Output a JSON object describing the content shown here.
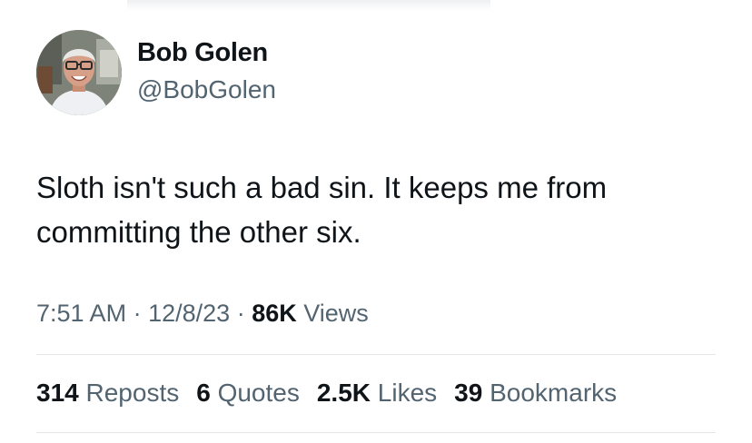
{
  "author": {
    "name": "Bob Golen",
    "handle": "@BobGolen"
  },
  "tweet": {
    "text": "Sloth isn't such a bad sin. It keeps me from committing the other six."
  },
  "meta": {
    "time": "7:51 AM",
    "separator": "·",
    "date": "12/8/23",
    "views_count": "86K",
    "views_label": "Views"
  },
  "stats": [
    {
      "count": "314",
      "label": "Reposts"
    },
    {
      "count": "6",
      "label": "Quotes"
    },
    {
      "count": "2.5K",
      "label": "Likes"
    },
    {
      "count": "39",
      "label": "Bookmarks"
    }
  ],
  "colors": {
    "primary_text": "#0f1419",
    "secondary_text": "#536471",
    "divider": "#e3e7ea"
  }
}
